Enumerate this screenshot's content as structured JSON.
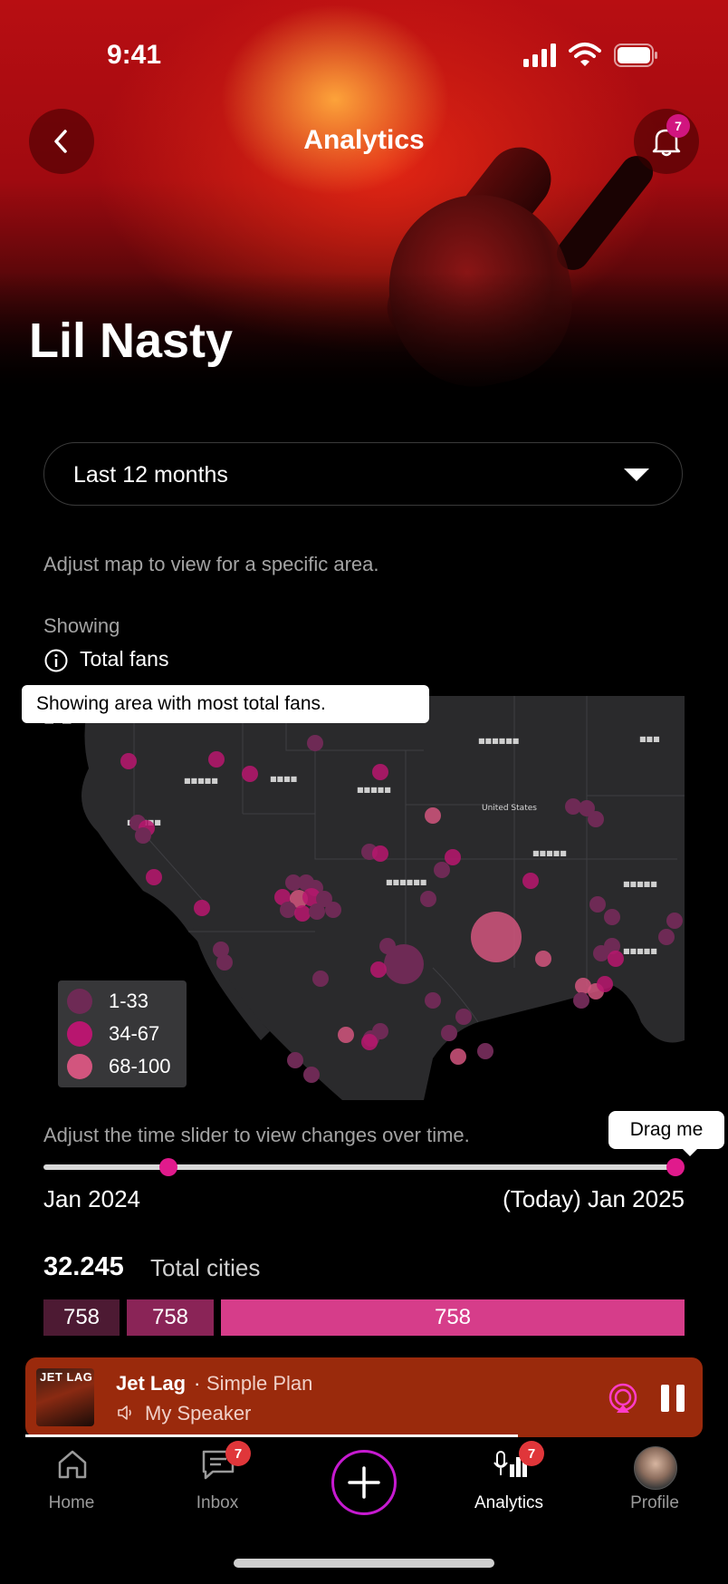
{
  "status_bar": {
    "time": "9:41"
  },
  "header": {
    "title": "Analytics",
    "notification_count": "7",
    "artist_name": "Lil Nasty"
  },
  "filter": {
    "period": "Last 12 months",
    "hint": "Adjust map to view for a specific area."
  },
  "showing": {
    "label": "Showing",
    "metric": "Total fans",
    "tooltip": "Showing area with most total fans."
  },
  "map": {
    "legend": [
      {
        "label": "1-33",
        "color": "#6e2a55"
      },
      {
        "label": "34-67",
        "color": "#b8166f"
      },
      {
        "label": "68-100",
        "color": "#d2557e"
      }
    ],
    "labels": [
      "United States"
    ]
  },
  "slider": {
    "hint": "Adjust the time slider to view changes over time.",
    "tooltip": "Drag me",
    "start_label": "Jan 2024",
    "end_label": "(Today) Jan 2025",
    "position": 1.0
  },
  "totals": {
    "value": "32.245",
    "label": "Total cities",
    "segments": [
      {
        "value": "758",
        "color": "#4d1a33"
      },
      {
        "value": "758",
        "color": "#8a2457"
      },
      {
        "value": "758",
        "color": "#d63d8a"
      }
    ]
  },
  "player": {
    "track": "Jet Lag",
    "separator": "·",
    "artist": "Simple Plan",
    "device": "My Speaker",
    "album_art_text": "JET LAG"
  },
  "tabs": [
    {
      "label": "Home",
      "icon": "home-icon"
    },
    {
      "label": "Inbox",
      "icon": "message-icon",
      "badge": "7"
    },
    {
      "label": "Analytics",
      "icon": "analytics-icon",
      "badge": "7",
      "active": true
    },
    {
      "label": "Profile",
      "icon": "avatar"
    }
  ],
  "colors": {
    "accent": "#e01a8c",
    "player_bg": "#9a2a0c",
    "badge": "#e0363a"
  }
}
